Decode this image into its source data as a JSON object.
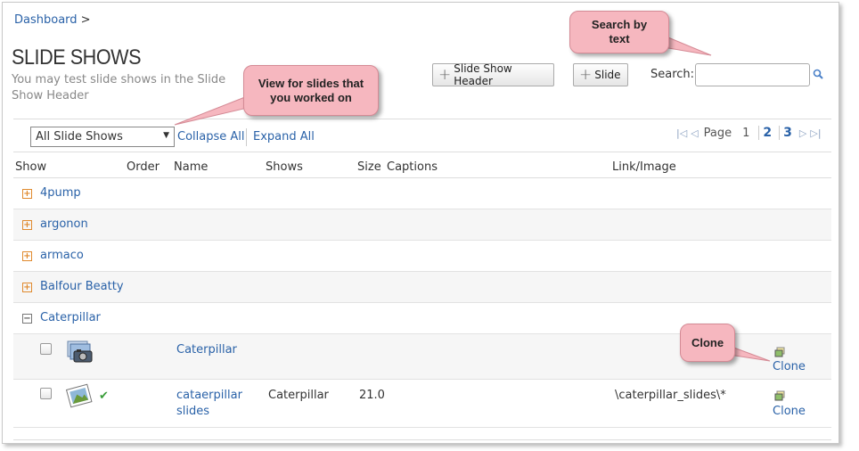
{
  "breadcrumb": {
    "link": "Dashboard",
    "separator": ">"
  },
  "page": {
    "title": "SLIDE SHOWS",
    "subtitle": "You may test slide shows in the Slide Show Header"
  },
  "toolbar": {
    "slide_show_header_label": "Slide Show Header",
    "slide_label": "Slide",
    "search_label": "Search:",
    "search_value": "",
    "filter_selected": "All Slide Shows",
    "collapse_all": "Collapse All",
    "expand_all": "Expand All"
  },
  "pager": {
    "label": "Page",
    "current": "1",
    "pages": [
      "2",
      "3"
    ]
  },
  "columns": [
    "Show",
    "Order",
    "Name",
    "Shows",
    "Size",
    "Captions",
    "Link/Image"
  ],
  "groups": [
    {
      "label": "4pump",
      "expanded": false
    },
    {
      "label": "argonon",
      "expanded": false
    },
    {
      "label": "armaco",
      "expanded": false
    },
    {
      "label": "Balfour Beatty",
      "expanded": false
    },
    {
      "label": "Caterpillar",
      "expanded": true
    }
  ],
  "rows": [
    {
      "name": "Caterpillar",
      "shows": "",
      "size": "",
      "captions": "",
      "link": "",
      "action": "Clone",
      "icon": "slideshow-camera-icon"
    },
    {
      "name_line1": "cataerpillar",
      "name_line2": "slides",
      "shows": "Caterpillar",
      "size": "21.0",
      "captions": "",
      "link": "\\caterpillar_slides\\*",
      "action": "Clone",
      "icon": "slide-image-icon"
    }
  ],
  "callouts": {
    "search": "Search by text",
    "view": "View for slides that you worked on",
    "clone": "Clone"
  },
  "colors": {
    "link": "#2a62a8",
    "expander": "#e08a2e",
    "callout_fill": "#f6b7bf",
    "row_alt": "#f6f6f6"
  }
}
